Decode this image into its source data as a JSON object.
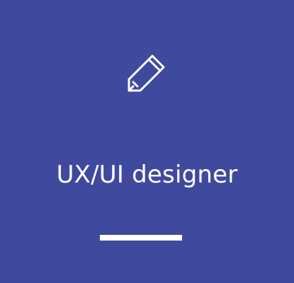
{
  "card": {
    "title": "UX/UI designer",
    "icon": "pencil-icon",
    "background_color": "#3f4a9e",
    "foreground_color": "#ffffff"
  }
}
